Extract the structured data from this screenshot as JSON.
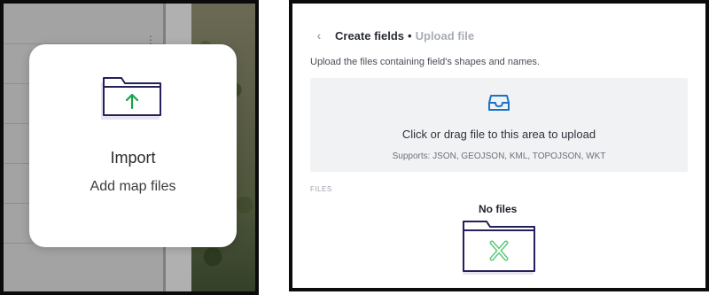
{
  "import_card": {
    "title": "Import",
    "subtitle": "Add map files",
    "icon": "folder-upload-icon",
    "accent_color": "#1aa34a"
  },
  "upload_panel": {
    "back_icon": "chevron-left-icon",
    "title": "Create fields",
    "separator": "•",
    "subtitle": "Upload file",
    "instructions": "Upload the files containing field's shapes and names.",
    "dropzone": {
      "icon": "inbox-icon",
      "text": "Click or drag file to this area to upload",
      "supports": "Supports: JSON, GEOJSON, KML, TOPOJSON, WKT",
      "icon_color": "#1a73c9"
    },
    "files_label": "FILES",
    "empty_title": "No files",
    "empty_icon": "folder-empty-icon",
    "empty_accent_color": "#5cc97a"
  }
}
